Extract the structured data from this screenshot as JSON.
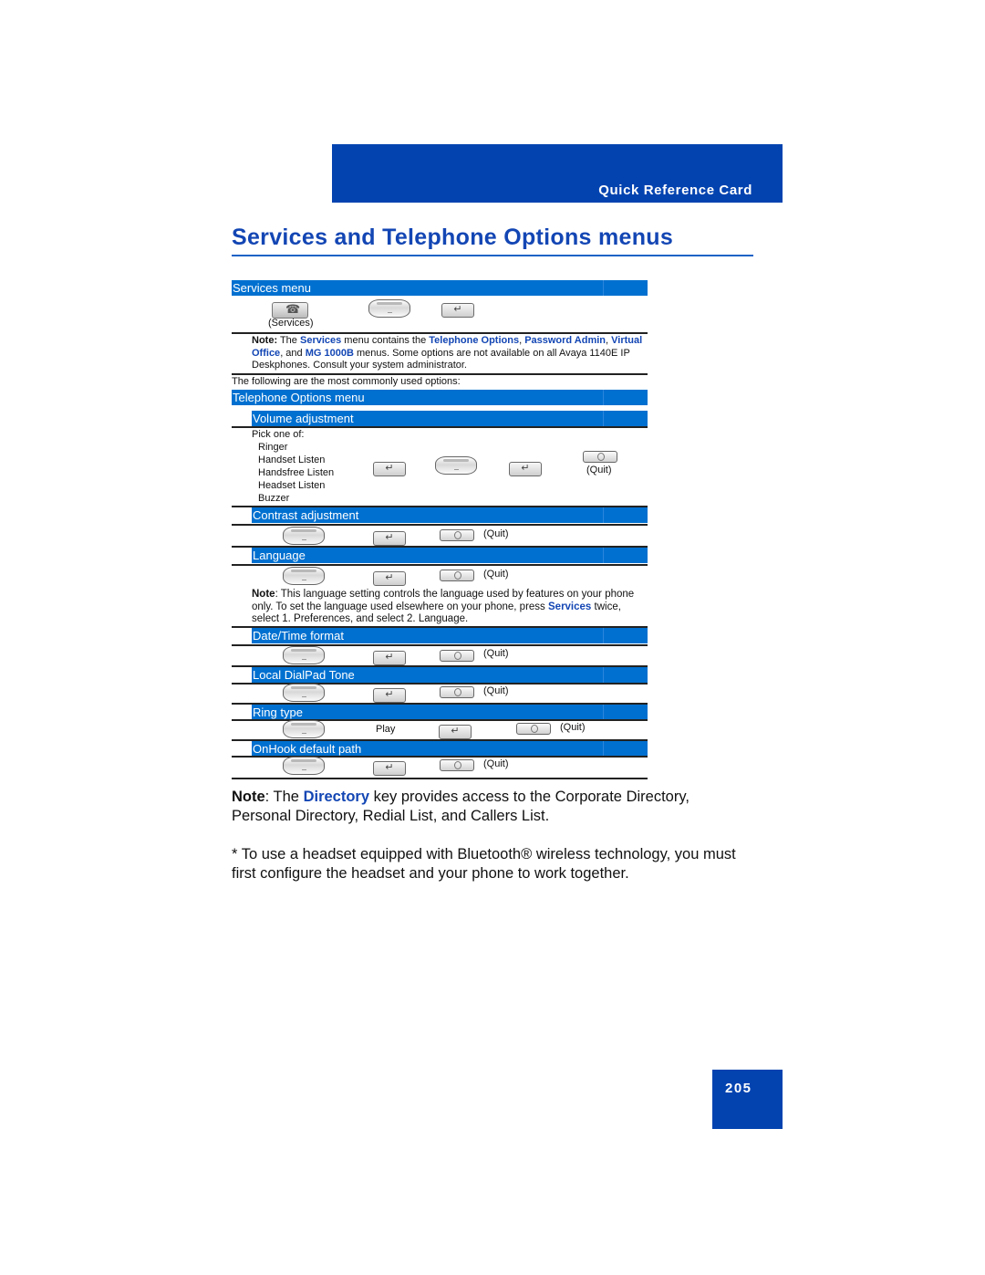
{
  "header": {
    "section_label": "Quick Reference Card"
  },
  "page_title": "Services and Telephone Options menus",
  "services_menu": {
    "title": "Services menu",
    "keys": [
      {
        "icon": "services-key-icon",
        "caption": "(Services)"
      },
      {
        "icon": "navigation-cluster-icon"
      },
      {
        "icon": "enter-key-icon",
        "glyph": "↵"
      }
    ],
    "note": {
      "label": "Note:",
      "t1": " The ",
      "services": "Services",
      "t2": " menu contains the ",
      "telephone_options": "Telephone Options",
      "t3": ", ",
      "password_admin": "Password Admin",
      "t4": ", ",
      "virtual_office": "Virtual Office",
      "t5": ", and ",
      "mg1000b": "MG 1000B",
      "t6": " menus. Some options are not available on all Avaya 1140E IP Deskphones. Consult your system administrator."
    },
    "common_options_text": "The following are the most commonly used options:"
  },
  "telephone_options_menu": {
    "title": "Telephone Options menu",
    "quit_label": "(Quit)",
    "enter_glyph": "↵",
    "sections": {
      "volume": {
        "title": "Volume adjustment",
        "pick_label": "Pick one of:",
        "options": [
          "Ringer",
          "Handset Listen",
          "Handsfree Listen",
          "Headset Listen",
          "Buzzer"
        ]
      },
      "contrast": {
        "title": "Contrast adjustment"
      },
      "language": {
        "title": "Language",
        "note_label": "Note",
        "note_t1": ": This language setting controls the language used by features on your phone only. To set the language used elsewhere on your phone, press ",
        "note_services": "Services",
        "note_t2": " twice, select 1. Preferences, and select 2. Language."
      },
      "datetime": {
        "title": "Date/Time format"
      },
      "dialpad_tone": {
        "title": "Local DialPad Tone"
      },
      "ring_type": {
        "title": "Ring type",
        "play_label": "Play"
      },
      "onhook": {
        "title": "OnHook default path"
      }
    }
  },
  "directory_note": {
    "label": "Note",
    "t1": ": The ",
    "directory": "Directory",
    "t2": " key provides access to the Corporate Directory, Personal Directory, Redial List, and Callers List."
  },
  "bluetooth_note": "* To use a headset equipped with Bluetooth® wireless technology, you must first configure the headset and your phone to work together.",
  "page_number": "205"
}
